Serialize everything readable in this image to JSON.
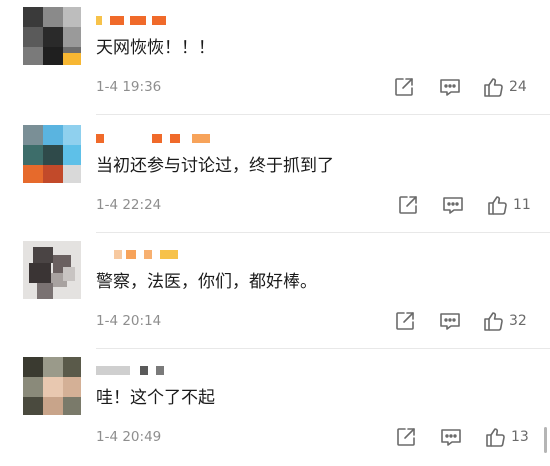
{
  "comments": [
    {
      "text": "天网恢恢！！！",
      "time": "1-4 19:36",
      "likes": "24"
    },
    {
      "text": "当初还参与讨论过，终于抓到了",
      "time": "1-4 22:24",
      "likes": "11"
    },
    {
      "text": "警察，法医，你们，都好棒。",
      "time": "1-4 20:14",
      "likes": "32"
    },
    {
      "text": "哇！这个了不起",
      "time": "1-4 20:49",
      "likes": "13"
    }
  ],
  "icons": {
    "share": "share-icon",
    "reply": "comment-icon",
    "like": "thumbs-up-icon"
  },
  "colors": {
    "text": "#1a1a1a",
    "meta": "#8e8e8e",
    "icon": "#6a6a6a",
    "username_mosaic_orange": "#f06a2a",
    "username_mosaic_yellow": "#f7c24a"
  }
}
